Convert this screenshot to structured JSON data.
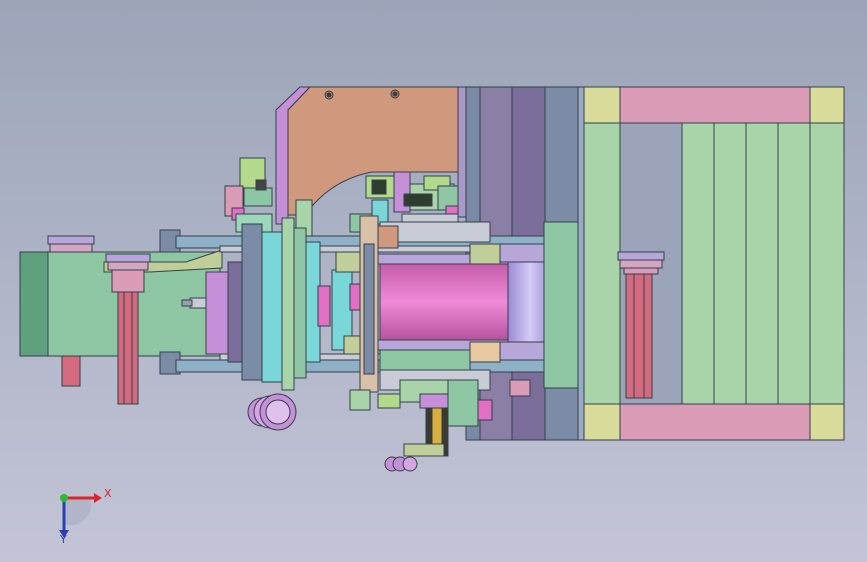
{
  "viewport": {
    "background_top": "#9ba4b8",
    "background_bottom": "#c3c5d6"
  },
  "triad": {
    "x_label": "X",
    "y_label": "Y",
    "x_color": "#d6262a",
    "y_color": "#2d3fb4",
    "origin_color": "#2fb63a"
  },
  "parts": {
    "frame_green": "#a9d3a8",
    "frame_pink": "#d99bb6",
    "frame_yellow": "#d8db9a",
    "plate_brown": "#d0997e",
    "plate_purple": "#7c6e9b",
    "plate_grey_blue": "#7d8ca6",
    "roller_magenta": "#e170c4",
    "roller_lavender": "#b9a9e9",
    "block_green": "#8fc7a5",
    "rod_blue": "#8fb1c8",
    "post_red": "#d46a80",
    "cyan": "#79d7d8",
    "cylinder_grey": "#c9ccd6"
  }
}
